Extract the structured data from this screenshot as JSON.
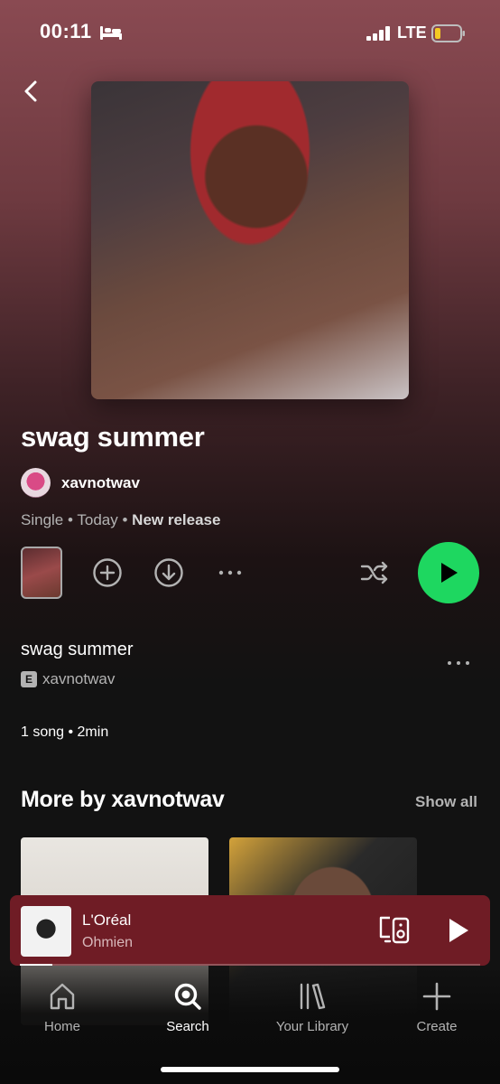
{
  "status_bar": {
    "time": "00:11",
    "network": "LTE",
    "icons": [
      "bed-icon",
      "signal-icon",
      "battery-icon"
    ]
  },
  "release": {
    "title": "swag summer",
    "artist": "xavnotwav",
    "type": "Single",
    "date": "Today",
    "tag": "New release",
    "separator": "•"
  },
  "controls": {
    "icons": [
      "add-icon",
      "download-icon",
      "more-icon",
      "shuffle-icon",
      "play-icon"
    ],
    "play_color": "#1ed760"
  },
  "tracks": [
    {
      "title": "swag summer",
      "explicit_label": "E",
      "artist": "xavnotwav"
    }
  ],
  "summary": "1 song • 2min",
  "more_by": {
    "heading": "More by xavnotwav",
    "show_all": "Show all"
  },
  "now_playing": {
    "title": "L'Oréal",
    "artist": "Ohmien",
    "progress": 0.07,
    "bar_color": "#6f1c25"
  },
  "bottom_nav": {
    "home": "Home",
    "search": "Search",
    "library": "Your Library",
    "create": "Create",
    "active": "Search"
  }
}
